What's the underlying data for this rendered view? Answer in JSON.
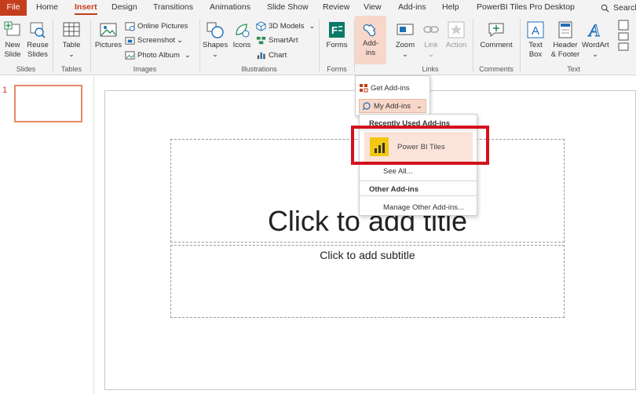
{
  "tabs": [
    {
      "label": "File"
    },
    {
      "label": "Home"
    },
    {
      "label": "Insert"
    },
    {
      "label": "Design"
    },
    {
      "label": "Transitions"
    },
    {
      "label": "Animations"
    },
    {
      "label": "Slide Show"
    },
    {
      "label": "Review"
    },
    {
      "label": "View"
    },
    {
      "label": "Add-ins"
    },
    {
      "label": "Help"
    },
    {
      "label": "PowerBI Tiles Pro Desktop"
    },
    {
      "label": "Search"
    }
  ],
  "ribbon": {
    "slides": {
      "label": "Slides",
      "new_slide": "New Slide",
      "reuse_slides": "Reuse Slides"
    },
    "tables": {
      "label": "Tables",
      "table": "Table"
    },
    "images": {
      "label": "Images",
      "pictures": "Pictures",
      "online_pictures": "Online Pictures",
      "screenshot": "Screenshot",
      "photo_album": "Photo Album"
    },
    "illustrations": {
      "label": "Illustrations",
      "shapes": "Shapes",
      "icons": "Icons",
      "models_3d": "3D Models",
      "smartart": "SmartArt",
      "chart": "Chart"
    },
    "forms": {
      "label": "Forms",
      "forms": "Forms"
    },
    "addins": {
      "label": "Add-ins",
      "line1": "Add-",
      "line2": "ins"
    },
    "links": {
      "label": "Links",
      "zoom": "Zoom",
      "link": "Link",
      "action": "Action"
    },
    "comments": {
      "label": "Comments",
      "comment": "Comment"
    },
    "text": {
      "label": "Text",
      "text_box_1": "Text",
      "text_box_2": "Box",
      "header_1": "Header",
      "header_2": "& Footer",
      "wordart": "WordArt"
    }
  },
  "slide_pane": {
    "slide_number": "1"
  },
  "slide": {
    "title_placeholder": "Click to add title",
    "subtitle_placeholder": "Click to add subtitle"
  },
  "addins_menu": {
    "get_addins": "Get Add-ins",
    "my_addins": "My Add-ins",
    "recently_used_header": "Recently Used Add-ins",
    "recent_item": "Power BI Tiles",
    "see_all": "See All...",
    "other_header": "Other Add-ins",
    "manage_other": "Manage Other Add-ins..."
  },
  "colors": {
    "accent": "#c43e1c",
    "highlight_box": "#d3121f",
    "selected_fill": "#f7d7c9",
    "powerbi_yellow": "#f2c811"
  }
}
